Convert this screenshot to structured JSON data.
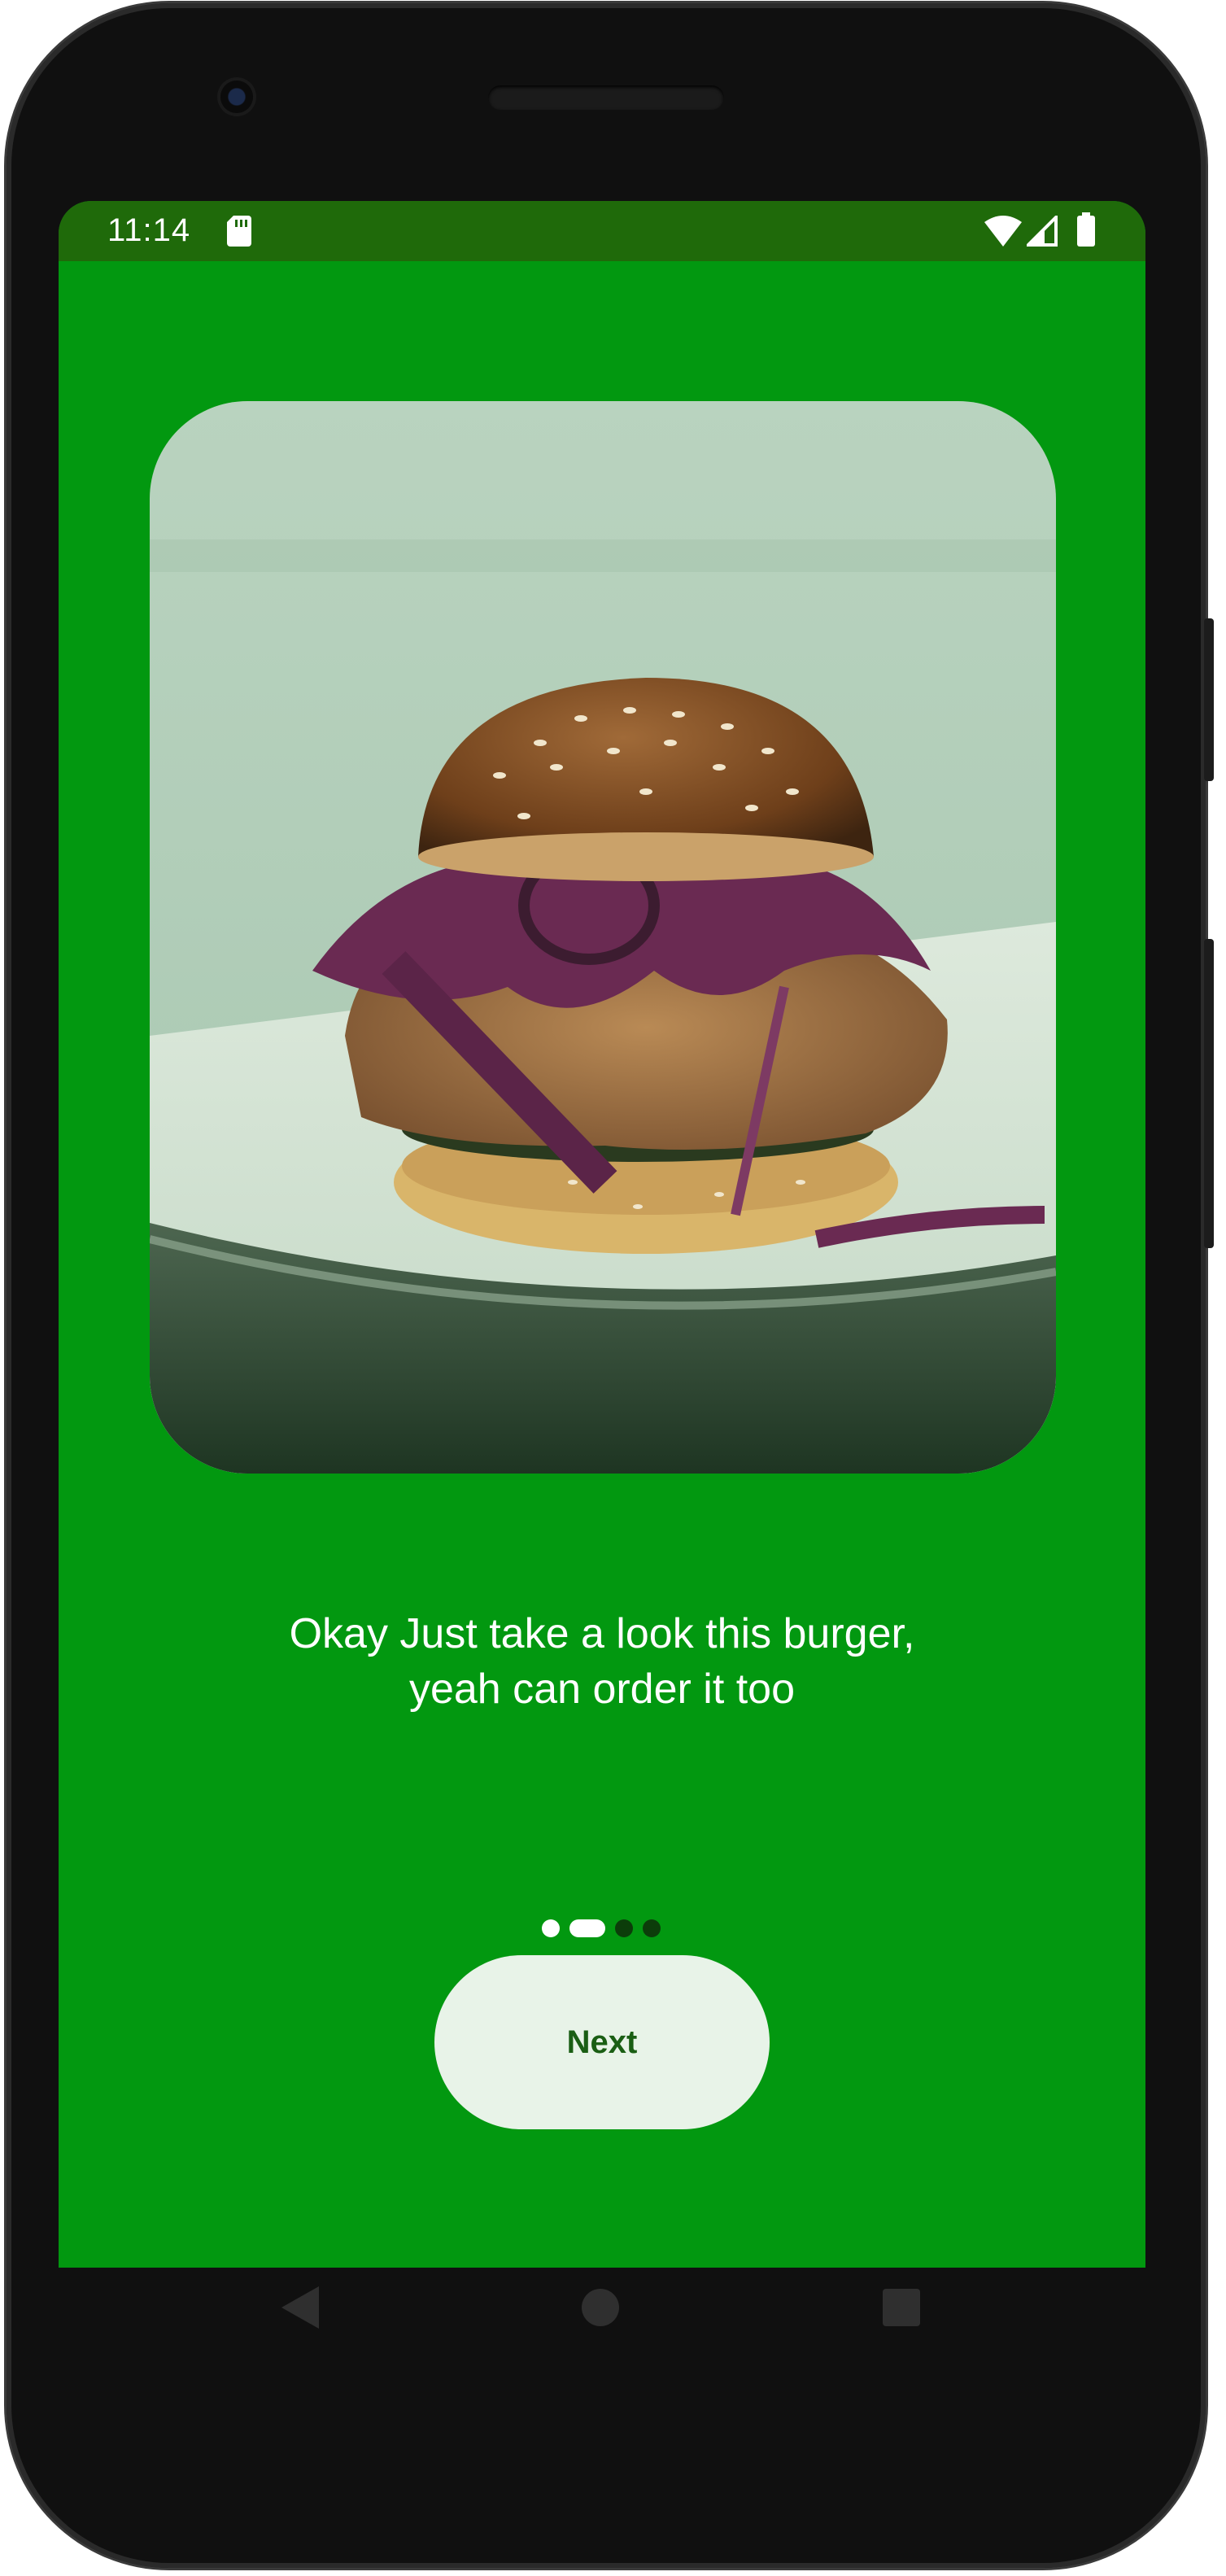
{
  "status_bar": {
    "time": "11:14",
    "icons": [
      "sd-card-icon",
      "wifi-icon",
      "signal-icon",
      "battery-icon"
    ]
  },
  "onboarding": {
    "image_alt": "burger-photo",
    "caption": "Okay Just take a look this burger,\nyeah can order it too",
    "page_indicator": {
      "pages": 4,
      "current": 2
    },
    "next_label": "Next"
  },
  "nav_bar": {
    "icons": [
      "back-icon",
      "home-icon",
      "recents-icon"
    ]
  },
  "colors": {
    "screen_bg": "#029810",
    "status_bar_bg": "#1f6a0a",
    "button_bg": "#e8f3e8",
    "button_text": "#1a5e14"
  }
}
